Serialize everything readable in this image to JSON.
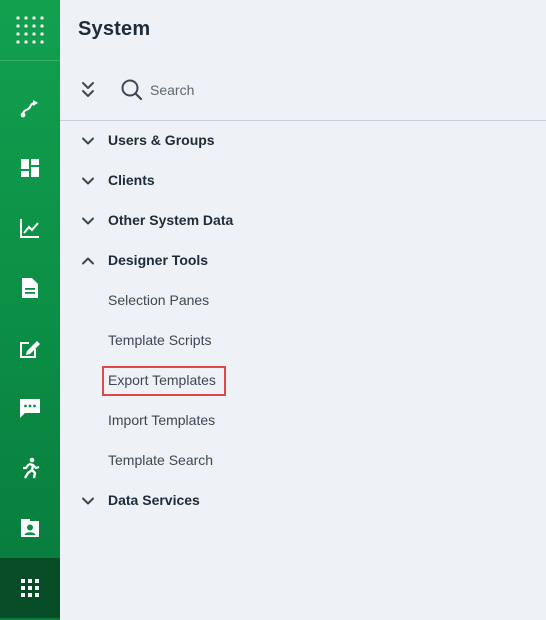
{
  "header": {
    "title": "System"
  },
  "toolbar": {
    "search_placeholder": "Search"
  },
  "rail": {
    "items": [
      {
        "icon": "grid-apps-icon"
      },
      {
        "icon": "route-icon"
      },
      {
        "icon": "dashboard-icon"
      },
      {
        "icon": "chart-line-icon"
      },
      {
        "icon": "document-icon"
      },
      {
        "icon": "edit-note-icon"
      },
      {
        "icon": "chat-icon"
      },
      {
        "icon": "running-person-icon"
      },
      {
        "icon": "contact-card-icon"
      },
      {
        "icon": "apps-grid-icon"
      }
    ],
    "active_index": 9
  },
  "tree": {
    "groups": [
      {
        "label": "Users & Groups",
        "expanded": false
      },
      {
        "label": "Clients",
        "expanded": false
      },
      {
        "label": "Other System Data",
        "expanded": false
      },
      {
        "label": "Designer Tools",
        "expanded": true,
        "children": [
          {
            "label": "Selection Panes"
          },
          {
            "label": "Template Scripts"
          },
          {
            "label": "Export Templates",
            "highlighted": true
          },
          {
            "label": "Import Templates"
          },
          {
            "label": "Template Search"
          }
        ]
      },
      {
        "label": "Data Services",
        "expanded": false
      }
    ]
  },
  "colors": {
    "rail_green": "#0b8d45",
    "rail_active": "#064d27",
    "highlight": "#e04848"
  }
}
